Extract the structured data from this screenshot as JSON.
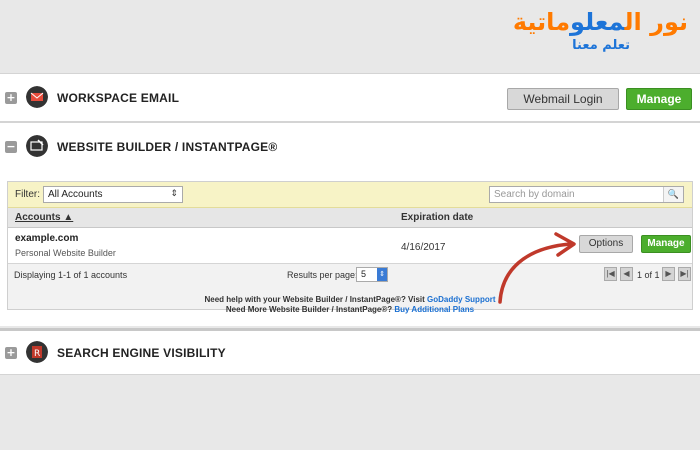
{
  "logo": {
    "part1": "نور ال",
    "part2": "معلو",
    "part3": "ماتية",
    "tagline": "تعلم معنا"
  },
  "email": {
    "toggle": "+",
    "title": "WORKSPACE EMAIL",
    "webmail_label": "Webmail Login",
    "manage_label": "Manage"
  },
  "builder": {
    "toggle": "−",
    "title": "WEBSITE BUILDER / INSTANTPAGE®",
    "filter_label": "Filter:",
    "filter_value": "All Accounts",
    "search_placeholder": "Search by domain",
    "col_accounts": "Accounts ▲",
    "col_expiration": "Expiration date",
    "rows": [
      {
        "name": "example.com",
        "type": "Personal Website Builder",
        "expiration": "4/16/2017",
        "options_label": "Options",
        "manage_label": "Manage"
      }
    ],
    "displaying": "Displaying 1-1 of 1 accounts",
    "rpp_label": "Results per page:",
    "rpp_value": "5",
    "page_text": "1 of 1",
    "help1_text": "Need help with your Website Builder / InstantPage®? Visit",
    "help1_link": "GoDaddy Support",
    "help2_text": "Need More Website Builder / InstantPage®?",
    "help2_link": "Buy Additional Plans"
  },
  "seo": {
    "toggle": "+",
    "title": "SEARCH ENGINE VISIBILITY"
  },
  "colors": {
    "accent_green": "#4cae2d",
    "arrow_red": "#c0392b",
    "link_blue": "#1a6fd1"
  }
}
